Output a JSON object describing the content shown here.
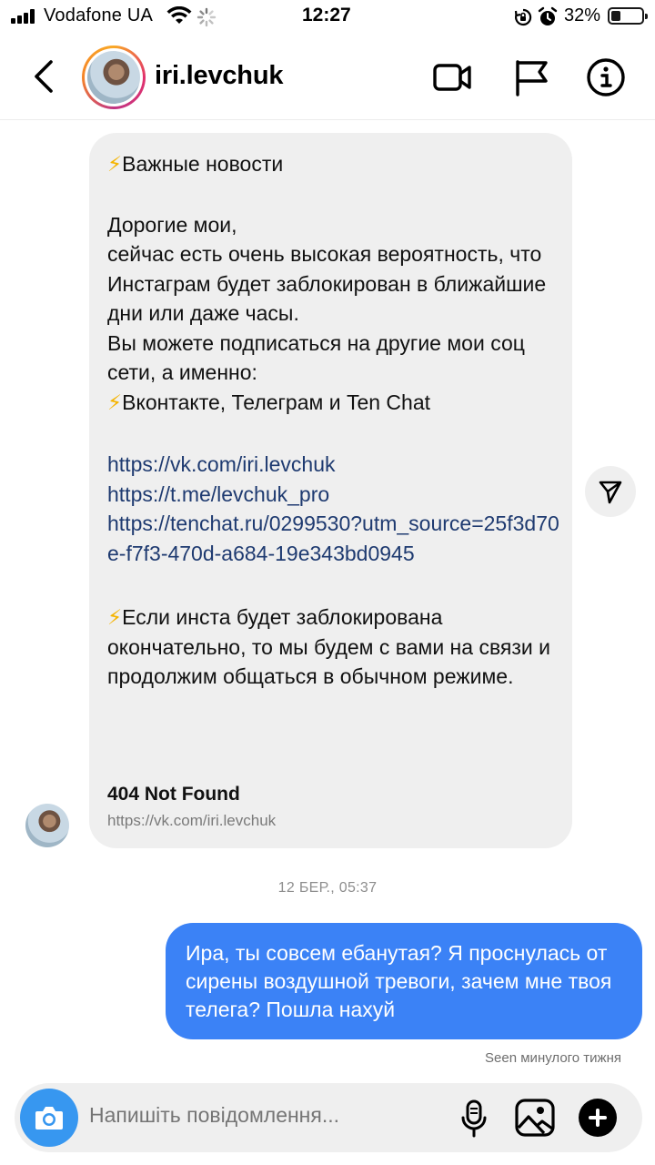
{
  "status_bar": {
    "carrier": "Vodafone UA",
    "time": "12:27",
    "battery_percent": "32%",
    "battery_level": 0.32,
    "icons": [
      "signal-icon",
      "wifi-icon",
      "loading-spinner-icon",
      "rotation-lock-icon",
      "alarm-icon",
      "battery-icon"
    ]
  },
  "header": {
    "username": "iri.levchuk",
    "icons": [
      "back-chevron-icon",
      "video-call-icon",
      "flag-icon",
      "info-icon"
    ]
  },
  "incoming_message": {
    "headline": "Важные новости",
    "lines_1": [
      "Дорогие мои,",
      "сейчас есть очень высокая вероятность, что Инстаграм будет заблокирован в ближайшие дни или даже часы.",
      "Вы можете подписаться на другие мои соц сети, а именно:"
    ],
    "networks_line": "Вконтакте, Телеграм и Ten Chat",
    "links": [
      "https://vk.com/iri.levchuk",
      "https://t.me/levchuk_pro",
      "https://tenchat.ru/0299530?utm_source=25f3d70e-f7f3-470d-a684-19e343bd0945"
    ],
    "closing": "Если инста будет заблокирована окончательно, то мы будем с вами на связи и продолжим общаться в обычном режиме.",
    "emoji": "⚡",
    "preview_title": "404 Not Found",
    "preview_url": "https://vk.com/iri.levchuk"
  },
  "timestamp": "12 БЕР., 05:37",
  "outgoing_message": {
    "text": "Ира, ты совсем ебанутая? Я проснулась от сирены воздушной тревоги, зачем мне твоя телега? Пошла нахуй"
  },
  "seen_label": "Seen минулого тижня",
  "composer": {
    "placeholder": "Напишіть повідомлення...",
    "icons": [
      "camera-icon",
      "microphone-icon",
      "gallery-icon",
      "plus-icon"
    ]
  },
  "colors": {
    "outgoing_bubble": "#3b82f6",
    "incoming_bubble": "#efefef",
    "link": "#1e3a70",
    "camera_button": "#3797f0"
  }
}
